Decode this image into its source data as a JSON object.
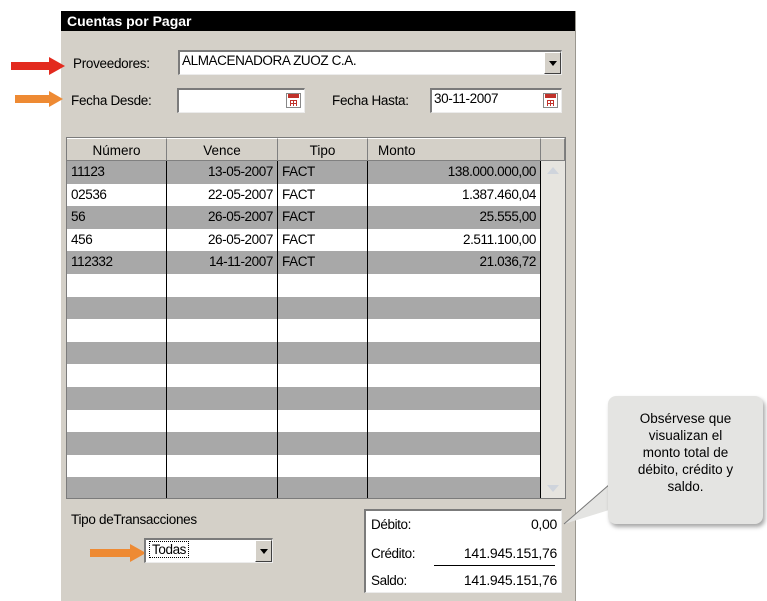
{
  "window": {
    "title": "Cuentas por Pagar"
  },
  "filters": {
    "proveedores_label": "Proveedores:",
    "proveedores_value": "ALMACENADORA ZUOZ C.A.",
    "fecha_desde_label": "Fecha Desde:",
    "fecha_desde_value": "",
    "fecha_hasta_label": "Fecha Hasta:",
    "fecha_hasta_value": "30-11-2007"
  },
  "table": {
    "columns": [
      "Número",
      "Vence",
      "Tipo",
      "Monto"
    ],
    "rows": [
      {
        "numero": "11123",
        "vence": "13-05-2007",
        "tipo": "FACT",
        "monto": "138.000.000,00"
      },
      {
        "numero": "02536",
        "vence": "22-05-2007",
        "tipo": "FACT",
        "monto": "1.387.460,04"
      },
      {
        "numero": "56",
        "vence": "26-05-2007",
        "tipo": "FACT",
        "monto": "25.555,00"
      },
      {
        "numero": "456",
        "vence": "26-05-2007",
        "tipo": "FACT",
        "monto": "2.511.100,00"
      },
      {
        "numero": "112332",
        "vence": "14-11-2007",
        "tipo": "FACT",
        "monto": "21.036,72"
      }
    ]
  },
  "transactions": {
    "label": "Tipo deTransacciones",
    "value": "Todas"
  },
  "summary": {
    "debito_label": "Débito:",
    "debito_value": "0,00",
    "credito_label": "Crédito:",
    "credito_value": "141.945.151,76",
    "saldo_label": "Saldo:",
    "saldo_value": "141.945.151,76"
  },
  "callout": {
    "lines": [
      "Obsérvese que",
      "visualizan el",
      "monto total de",
      "débito, crédito y",
      "saldo."
    ]
  },
  "colors": {
    "red_arrow": "#e32a1e",
    "orange_arrow": "#ee8a33",
    "row_dark": "#a8a8a8",
    "panel": "#d4d0c8"
  },
  "icons": [
    "red-arrow-icon",
    "orange-arrow-icon",
    "calendar-icon",
    "dropdown-arrow-icon",
    "scroll-up-icon",
    "scroll-down-icon"
  ]
}
